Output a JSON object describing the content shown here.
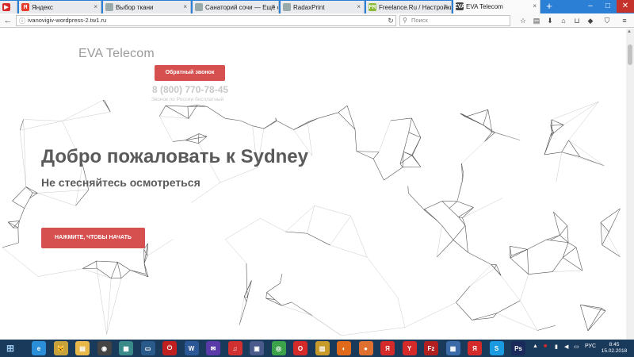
{
  "browser": {
    "tabs": [
      {
        "label": "",
        "icon": "youtube-icon",
        "color": "#d42a2a",
        "glyph": "▶"
      },
      {
        "label": "Яндекс",
        "icon": "yandex-icon",
        "color": "#e63a2a",
        "glyph": "Я"
      },
      {
        "label": "Выбор ткани",
        "icon": "page-icon",
        "color": "#9aa",
        "glyph": ""
      },
      {
        "label": "Санаторий сочи — Ещё один...",
        "icon": "page-icon",
        "color": "#9aa",
        "glyph": ""
      },
      {
        "label": "RadaxPrint",
        "icon": "page-icon",
        "color": "#9aa",
        "glyph": ""
      },
      {
        "label": "Freelance.Ru / Настройки...",
        "icon": "freelance-icon",
        "color": "#8ab837",
        "glyph": "FR"
      },
      {
        "label": "EVA Telecom",
        "icon": "eva-icon",
        "color": "#444",
        "glyph": "EVA"
      }
    ],
    "new_tab": "+",
    "window": {
      "minimize": "–",
      "maximize": "□",
      "close": "✕"
    },
    "url": "ivanovigiv-wordpress-2.tw1.ru",
    "search_placeholder": "Поиск"
  },
  "site": {
    "brand": "EVA Telecom",
    "callback_button": "Обратный звонок",
    "phone": "8 (800) 770-78-45",
    "phone_note": "Звонок по России бесплатный",
    "hero_title": "Добро пожаловать к Sydney",
    "hero_subtitle": "Не стесняйтесь осмотреться",
    "cta_button": "НАЖМИТЕ, ЧТОБЫ НАЧАТЬ"
  },
  "taskbar": {
    "apps": [
      {
        "name": "ie-icon",
        "color": "#2a8fd8",
        "glyph": "e"
      },
      {
        "name": "cat-icon",
        "color": "#c7a23a",
        "glyph": "🐱"
      },
      {
        "name": "explorer-icon",
        "color": "#e8b84a",
        "glyph": "▤"
      },
      {
        "name": "camera-icon",
        "color": "#444",
        "glyph": "◉"
      },
      {
        "name": "photos-icon",
        "color": "#3a8a8a",
        "glyph": "▦"
      },
      {
        "name": "window-icon",
        "color": "#2a5a8a",
        "glyph": "▭"
      },
      {
        "name": "power-icon",
        "color": "#c02020",
        "glyph": "⏻"
      },
      {
        "name": "word-icon",
        "color": "#2b5797",
        "glyph": "W"
      },
      {
        "name": "mail-icon",
        "color": "#5a3aa8",
        "glyph": "✉"
      },
      {
        "name": "music-icon",
        "color": "#d03030",
        "glyph": "♫"
      },
      {
        "name": "floppy-icon",
        "color": "#4a5a8a",
        "glyph": "▣"
      },
      {
        "name": "chrome-icon",
        "color": "#3ca24a",
        "glyph": "◎"
      },
      {
        "name": "opera-icon",
        "color": "#d42a2a",
        "glyph": "O"
      },
      {
        "name": "archive-icon",
        "color": "#c89a2a",
        "glyph": "▥"
      },
      {
        "name": "firefox-icon",
        "color": "#e06a1a",
        "glyph": "◐"
      },
      {
        "name": "basketball-icon",
        "color": "#e07030",
        "glyph": "●"
      },
      {
        "name": "yandex-icon",
        "color": "#d42a2a",
        "glyph": "Я"
      },
      {
        "name": "yandex-browser-icon",
        "color": "#d42a2a",
        "glyph": "Y"
      },
      {
        "name": "filezilla-icon",
        "color": "#b02020",
        "glyph": "Fz"
      },
      {
        "name": "calculator-icon",
        "color": "#3a6aa8",
        "glyph": "▦"
      },
      {
        "name": "yandex-disk-icon",
        "color": "#d42a2a",
        "glyph": "Я"
      },
      {
        "name": "skype-icon",
        "color": "#1a9ae0",
        "glyph": "S"
      },
      {
        "name": "photoshop-icon",
        "color": "#1a2a5a",
        "glyph": "Ps"
      }
    ],
    "language": "РУС",
    "time": "8:45",
    "date": "15.02.2018"
  }
}
